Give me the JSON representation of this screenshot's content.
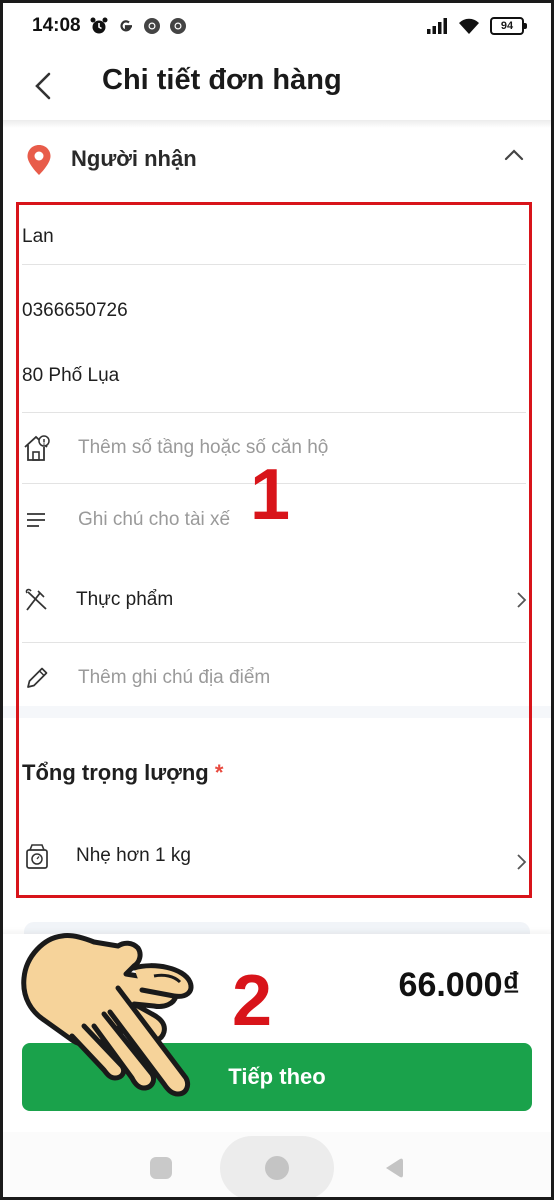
{
  "status_bar": {
    "time": "14:08",
    "battery": "94"
  },
  "header": {
    "title": "Chi tiết đơn hàng"
  },
  "recipient": {
    "section_title": "Người nhận",
    "name": "Lan",
    "phone": "0366650726",
    "address": "80 Phố Lụa",
    "floor_placeholder": "Thêm số tầng hoặc số căn hộ",
    "driver_note_placeholder": "Ghi chú cho tài xế",
    "goods_type": "Thực phẩm",
    "location_note_placeholder": "Thêm ghi chú địa điểm"
  },
  "weight": {
    "title": "Tổng trọng lượng",
    "required_mark": "*",
    "value": "Nhẹ hơn 1 kg"
  },
  "footer": {
    "price": "66.000₫",
    "next_button": "Tiếp theo"
  },
  "annotations": {
    "label_1": "1",
    "label_2": "2"
  },
  "colors": {
    "primary_green": "#1aa24b",
    "annotation_red": "#d8141a",
    "pin_red": "#e85c4a"
  }
}
